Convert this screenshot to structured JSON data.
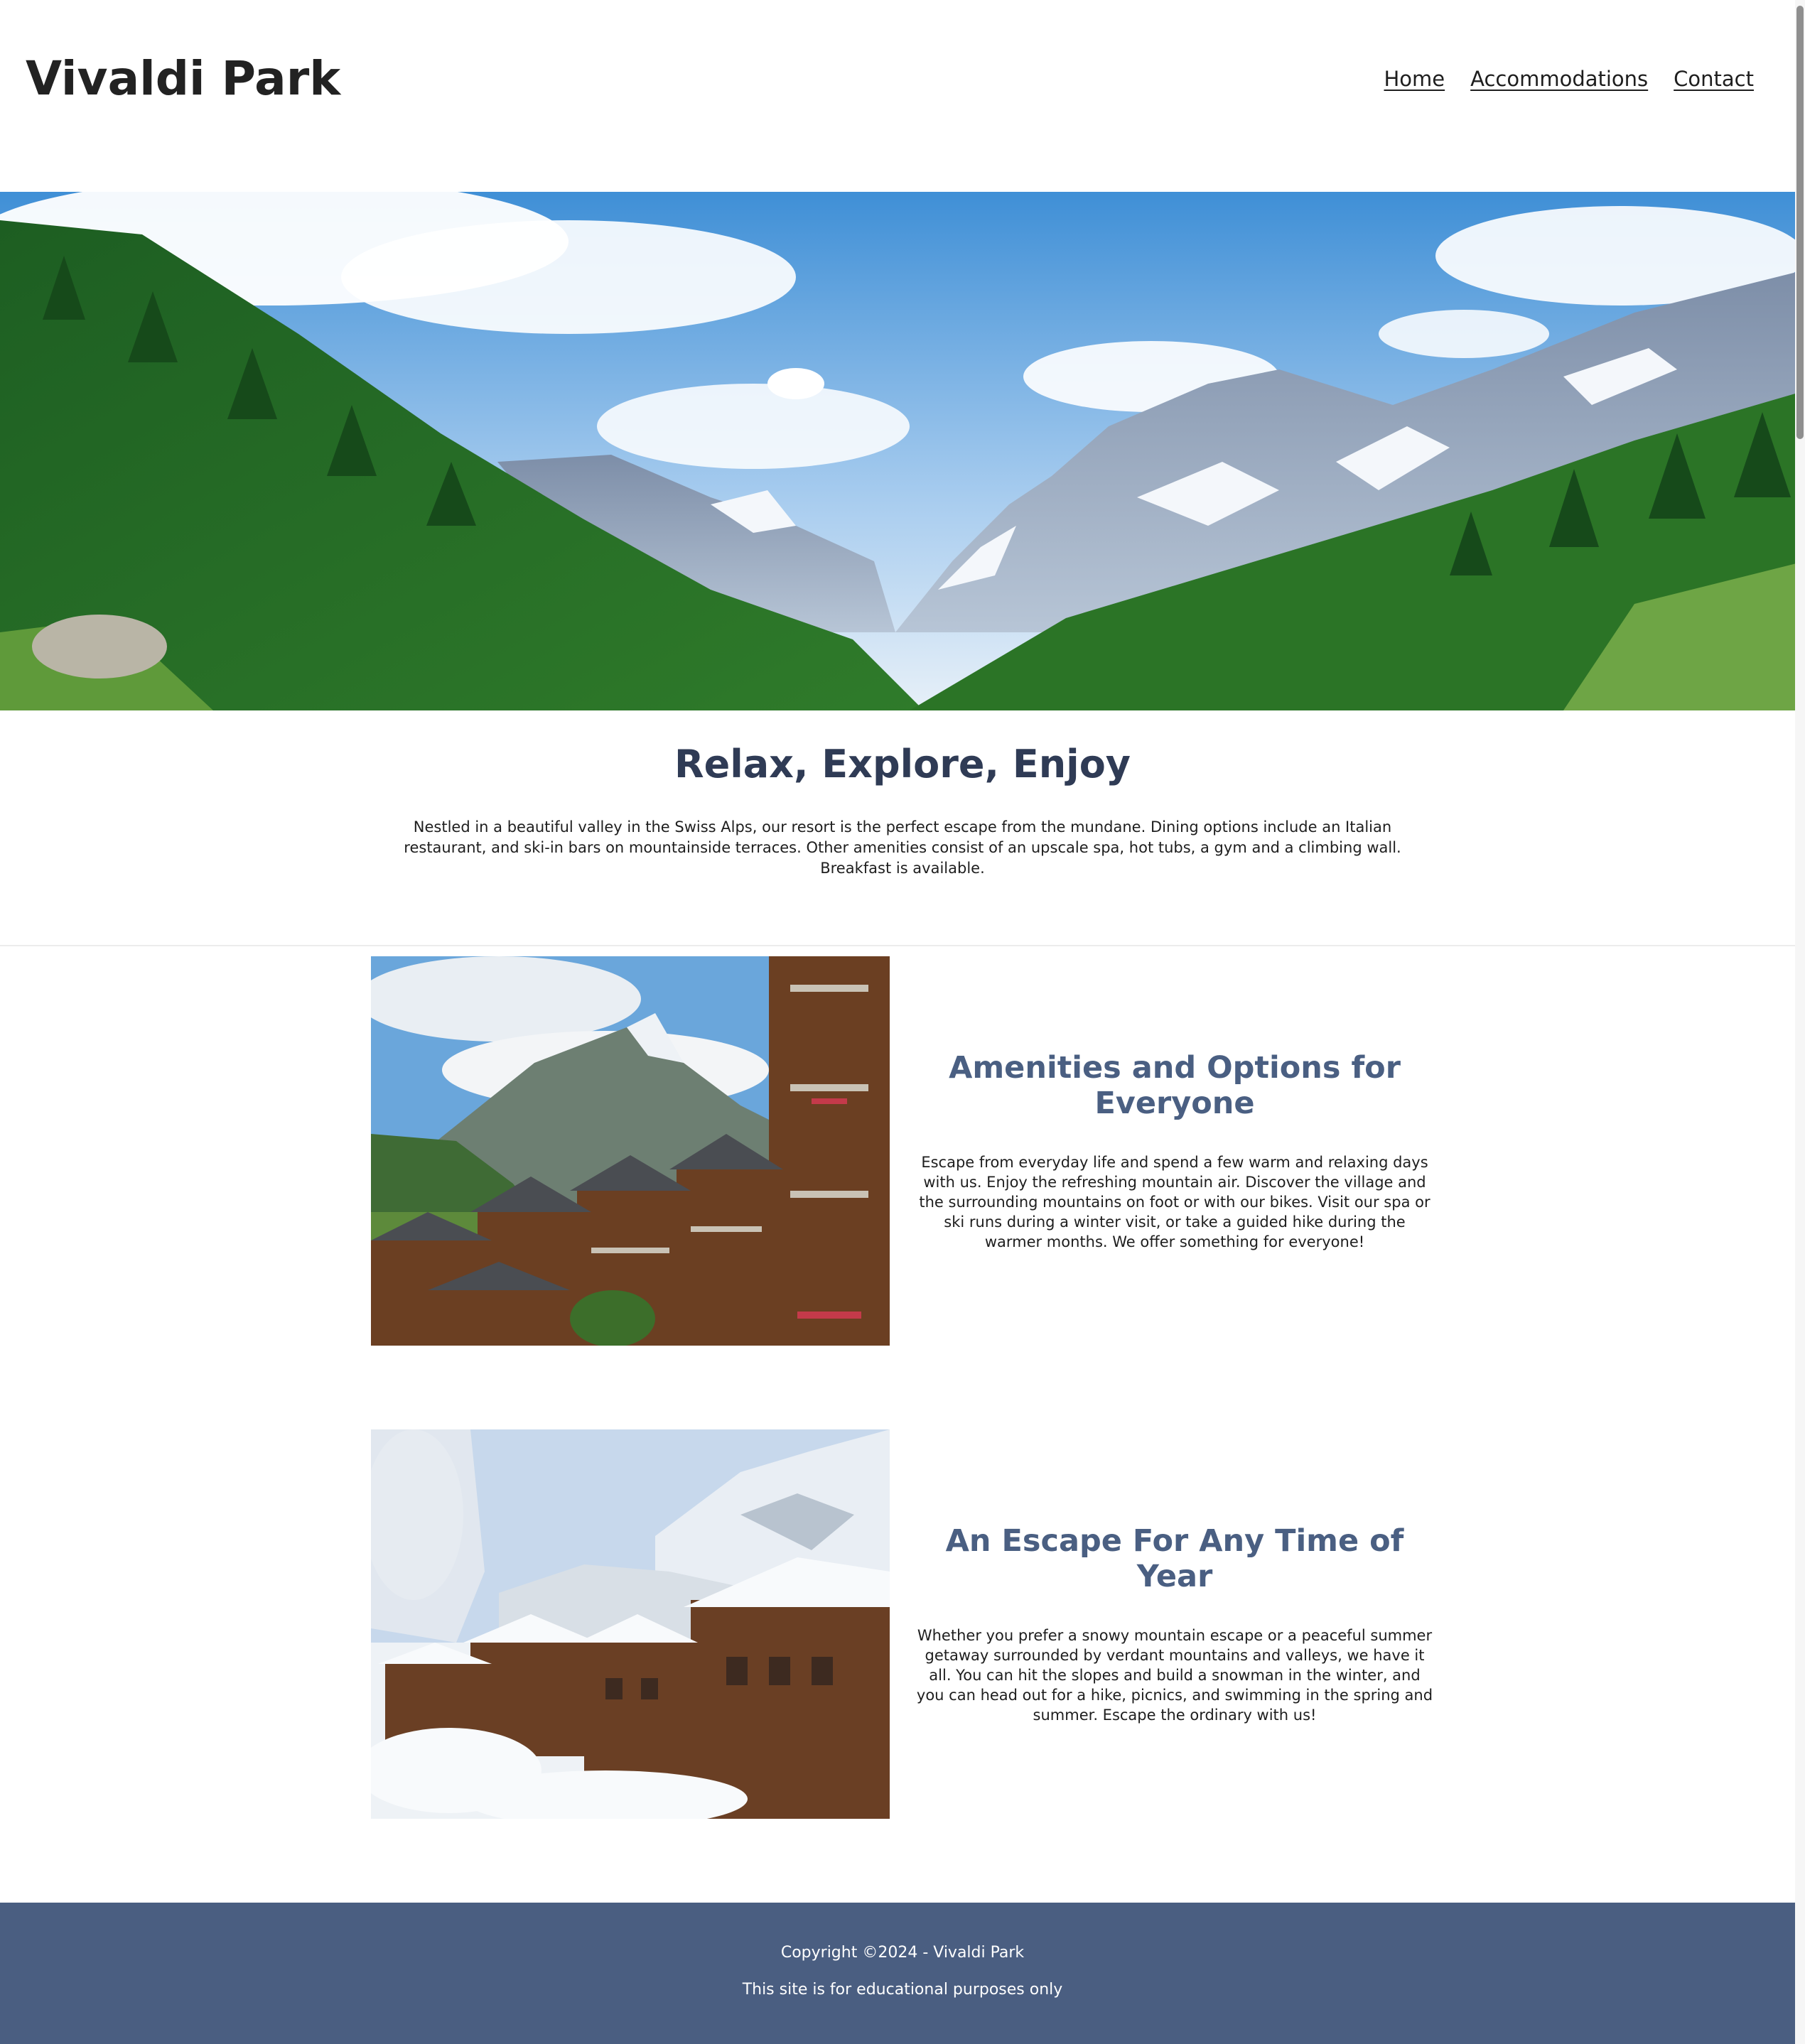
{
  "header": {
    "brand": "Vivaldi Park",
    "nav": [
      {
        "label": "Home"
      },
      {
        "label": "Accommodations"
      },
      {
        "label": "Contact"
      }
    ]
  },
  "hero": {
    "image": "alpine-valley-mountain-photo"
  },
  "intro": {
    "title": "Relax, Explore, Enjoy",
    "body": "Nestled in a beautiful valley in the Swiss Alps, our resort is the perfect escape from the mundane. Dining options include an Italian restaurant, and ski-in bars on mountainside terraces. Other amenities consist of an upscale spa, hot tubs, a gym and a climbing wall. Breakfast is available."
  },
  "features": [
    {
      "image": "alpine-village-summer-photo",
      "title": "Amenities and Options for Everyone",
      "body": "Escape from everyday life and spend a few warm and relaxing days with us. Enjoy the refreshing mountain air. Discover the village and the surrounding mountains on foot or with our bikes. Visit our spa or ski runs during a winter visit, or take a guided hike during the warmer months. We offer something for everyone!"
    },
    {
      "image": "alpine-village-winter-photo",
      "title": "An Escape For Any Time of Year",
      "body": "Whether you prefer a snowy mountain escape or a peaceful summer getaway surrounded by verdant mountains and valleys, we have it all. You can hit the slopes and build a snowman in the winter, and you can head out for a hike, picnics, and swimming in the spring and summer. Escape the ordinary with us!"
    }
  ],
  "footer": {
    "copyright": "Copyright ©2024 - Vivaldi Park",
    "note": "This site is for educational purposes only"
  },
  "colors": {
    "heading_dark": "#2f3b55",
    "heading_accent": "#4a5f82",
    "footer_bg": "#4a5e81"
  }
}
